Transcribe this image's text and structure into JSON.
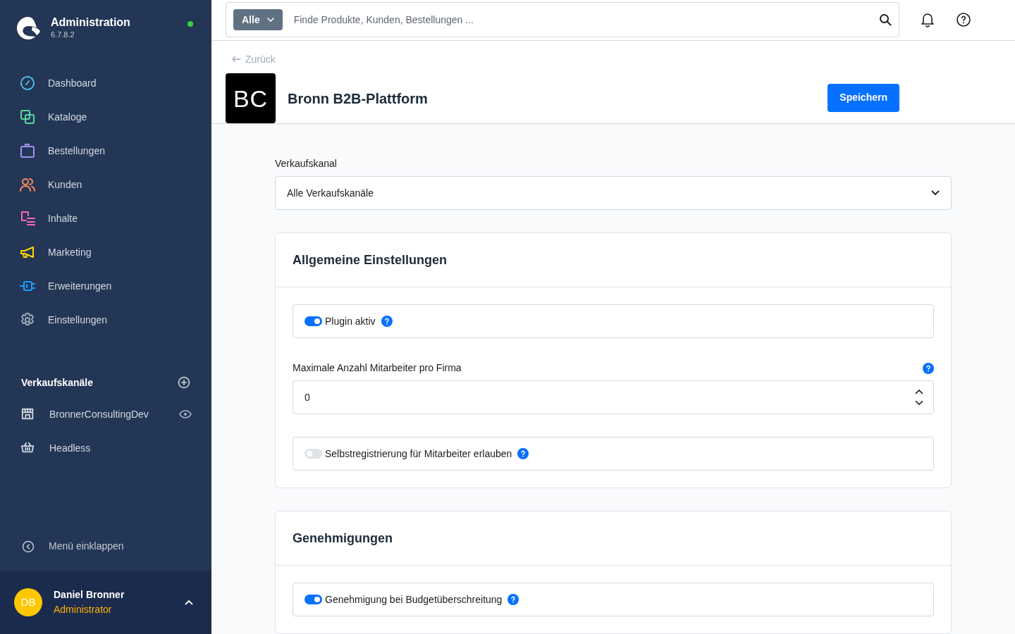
{
  "sidebar": {
    "app_title": "Administration",
    "version": "6.7.8.2",
    "online": true,
    "nav_items": [
      {
        "label": "Dashboard",
        "kind": "gauge",
        "color": "#52c6ea"
      },
      {
        "label": "Kataloge",
        "kind": "copies",
        "color": "#57d9a3"
      },
      {
        "label": "Bestellungen",
        "kind": "bag",
        "color": "#a092f0"
      },
      {
        "label": "Kunden",
        "kind": "users",
        "color": "#f88962"
      },
      {
        "label": "Inhalte",
        "kind": "content",
        "color": "#ff68b4"
      },
      {
        "label": "Marketing",
        "kind": "megaphone",
        "color": "#ffd700"
      },
      {
        "label": "Erweiterungen",
        "kind": "plug",
        "color": "#189eff"
      },
      {
        "label": "Einstellungen",
        "kind": "gear",
        "color": "#9aa8b5"
      }
    ],
    "sales_channels": {
      "title": "Verkaufskanäle",
      "items": [
        {
          "label": "BronnerConsultingDev",
          "kind": "storefront",
          "preview": true
        },
        {
          "label": "Headless",
          "kind": "basket",
          "preview": false
        }
      ]
    },
    "collapse_label": "Menü einklappen",
    "user": {
      "initials": "DB",
      "name": "Daniel Bronner",
      "role": "Administrator"
    }
  },
  "search": {
    "filter": "Alle",
    "placeholder": "Finde Produkte, Kunden, Bestellungen ..."
  },
  "page": {
    "back": "Zurück",
    "logo_text": "BC",
    "title": "Bronn B2B-Plattform",
    "save": "Speichern"
  },
  "sales_channel_select": {
    "label": "Verkaufskanal",
    "value": "Alle Verkaufskanäle"
  },
  "cards": [
    {
      "title": "Allgemeine Einstellungen",
      "fields": [
        {
          "kind": "switch",
          "label": "Plugin aktiv",
          "on": true,
          "help": true
        },
        {
          "kind": "number",
          "label": "Maximale Anzahl Mitarbeiter pro Firma",
          "value": "0",
          "help": true
        },
        {
          "kind": "switch",
          "label": "Selbstregistrierung für Mitarbeiter erlauben",
          "on": false,
          "help": true
        }
      ]
    },
    {
      "title": "Genehmigungen",
      "fields": [
        {
          "kind": "switch",
          "label": "Genehmigung bei Budgetüberschreitung",
          "on": true,
          "help": true
        }
      ]
    }
  ]
}
